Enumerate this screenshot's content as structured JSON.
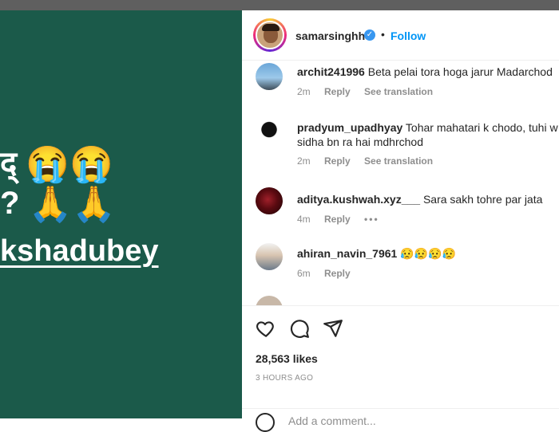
{
  "media": {
    "line1": "द्",
    "line1_emoji": "😭😭",
    "line2": "?",
    "line2_emoji": "🙏🙏",
    "line3": "kshadubey"
  },
  "header": {
    "username": "samarsinghh",
    "verified_icon": "verified-badge-icon",
    "separator": "•",
    "follow_label": "Follow"
  },
  "comments": [
    {
      "user": "archit241996",
      "text": "Beta pelai tora hoga jarur Madarchod",
      "time": "2m",
      "reply": "Reply",
      "translate": "See translation"
    },
    {
      "user": "pradyum_upadhyay",
      "text": "Tohar mahatari k chodo, tuhi w sidha bn ra hai mdhrchod",
      "time": "2m",
      "reply": "Reply",
      "translate": "See translation"
    },
    {
      "user": "aditya.kushwah.xyz___",
      "text": "Sara sakh tohre par jata",
      "time": "4m",
      "reply": "Reply",
      "more": "•••"
    },
    {
      "user": "ahiran_navin_7961",
      "text": "😥😥😥😥",
      "time": "6m",
      "reply": "Reply"
    }
  ],
  "actions": {
    "likes": "28,563 likes",
    "posted": "3 HOURS AGO",
    "add_comment_placeholder": "Add a comment..."
  },
  "colors": {
    "media_bg": "#1b5a4a",
    "link_blue": "#0095f6",
    "meta_gray": "#8e8e8e"
  }
}
